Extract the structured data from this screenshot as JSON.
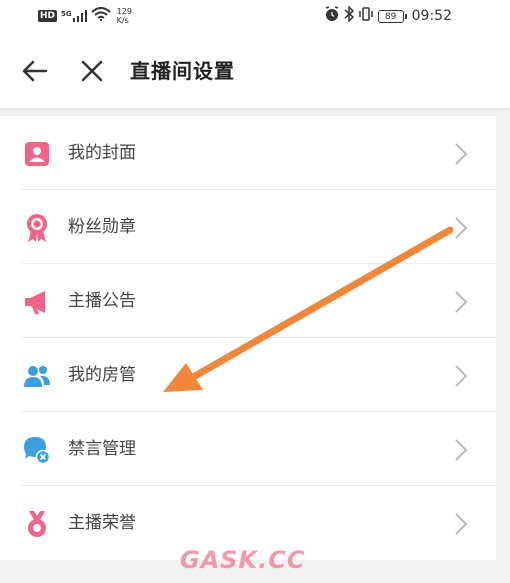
{
  "status_bar": {
    "hd": "HD",
    "signal": "5G",
    "net_speed_value": "129",
    "net_speed_unit": "K/s",
    "battery": "89",
    "time": "09:52"
  },
  "header": {
    "title": "直播间设置"
  },
  "settings": {
    "items": [
      {
        "label": "我的封面",
        "icon": "cover-icon",
        "color": "#f06487"
      },
      {
        "label": "粉丝勋章",
        "icon": "medal-icon",
        "color": "#f06487"
      },
      {
        "label": "主播公告",
        "icon": "megaphone-icon",
        "color": "#f06487"
      },
      {
        "label": "我的房管",
        "icon": "admins-icon",
        "color": "#3d9fe0"
      },
      {
        "label": "禁言管理",
        "icon": "mute-icon",
        "color": "#3d9fe0"
      },
      {
        "label": "主播荣誉",
        "icon": "honor-icon",
        "color": "#f06487"
      }
    ]
  },
  "annotation": {
    "arrow_color": "#f0873a"
  },
  "watermark": "GASK.CC"
}
